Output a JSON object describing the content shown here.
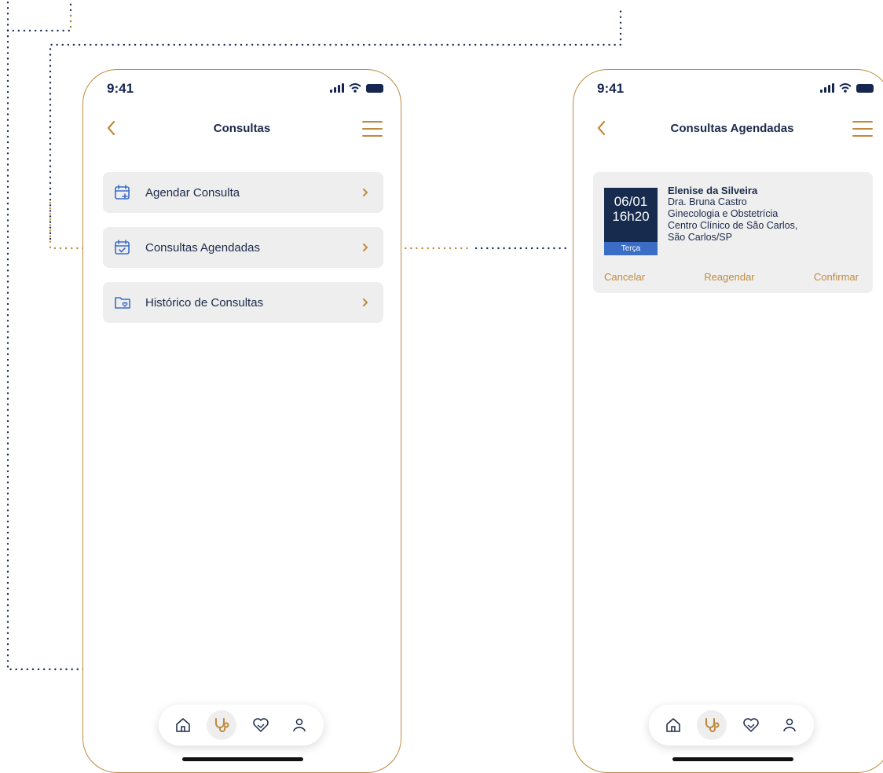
{
  "colors": {
    "accent": "#c08a3e",
    "navy": "#162b4d",
    "day_blue": "#3c6dc6",
    "card_bg": "#eeeeee"
  },
  "screen_a": {
    "time": "9:41",
    "title": "Consultas",
    "items": [
      {
        "label": "Agendar Consulta",
        "icon": "calendar-plus-icon"
      },
      {
        "label": "Consultas Agendadas",
        "icon": "calendar-check-icon"
      },
      {
        "label": "Histórico de Consultas",
        "icon": "folder-heart-icon"
      }
    ]
  },
  "screen_b": {
    "time": "9:41",
    "title": "Consultas Agendadas",
    "appointment": {
      "date": "06/01",
      "time": "16h20",
      "weekday": "Terça",
      "patient": "Elenise da Silveira",
      "doctor": "Dra. Bruna Castro",
      "specialty": "Ginecologia e Obstetrícia",
      "clinic_line1": "Centro Clínico de São Carlos,",
      "clinic_line2": "São Carlos/SP",
      "actions": {
        "cancel": "Cancelar",
        "reschedule": "Reagendar",
        "confirm": "Confirmar"
      }
    }
  },
  "tab_bar": [
    "home-icon",
    "stethoscope-icon",
    "heart-hand-icon",
    "user-icon"
  ],
  "active_tab": "stethoscope-icon"
}
